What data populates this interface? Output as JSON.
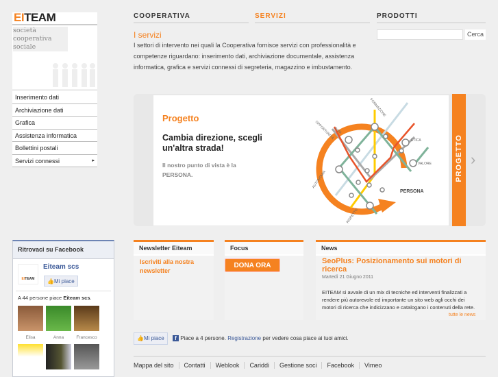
{
  "logo": {
    "brand_accent": "EI",
    "brand_rest": "TEAM",
    "tagline": [
      "società",
      "cooperativa",
      "sociale"
    ]
  },
  "nav": [
    {
      "label": "COOPERATIVA"
    },
    {
      "label": "SERVIZI",
      "active": true
    },
    {
      "label": "PRODOTTI"
    }
  ],
  "page": {
    "title": "I servizi",
    "intro": "I settori di intervento nei quali la Cooperativa fornisce servizi con professionalità e competenze riguardano: inserimento dati, archiviazione documentale, assistenza informatica, grafica e servizi connessi di segreteria, magazzino e imbustamento."
  },
  "search": {
    "value": "",
    "button": "Cerca"
  },
  "sidebar": {
    "items": [
      {
        "label": "Inserimento dati"
      },
      {
        "label": "Archiviazione dati"
      },
      {
        "label": "Grafica"
      },
      {
        "label": "Assistenza informatica"
      },
      {
        "label": "Bollettini postali"
      },
      {
        "label": "Servizi connessi",
        "submenu": "▸"
      }
    ]
  },
  "banner": {
    "kicker": "Progetto",
    "headline": "Cambia direzione, scegli un'altra strada!",
    "sub": "Il nostro punto di vista è la PERSONA.",
    "side_label": "PROGETTO",
    "next": "›",
    "diagram_labels": {
      "formazione": "FORMAZIONE",
      "pari": "PARI",
      "opportunita": "OPPORTUNITÀ",
      "etica": "ETICA",
      "valore": "VALORE",
      "autonomia": "AUTONOMIA",
      "rispetto": "RISPETTO",
      "persona": "PERSONA"
    }
  },
  "newsletter": {
    "title": "Newsletter Eiteam",
    "link": "Iscriviti alla nostra newsletter"
  },
  "focus": {
    "title": "Focus",
    "button": "DONA ORA"
  },
  "news": {
    "title": "News",
    "headline": "SeoPlus: Posizionamento sui motori di ricerca",
    "date": "Martedì 21 Giugno 2011",
    "body": "EITEAM si avvale di un mix di tecniche ed interventi finalizzati a rendere più autorevole ed importante un sito web agli occhi dei motori di ricerca che indicizzano e catalogano i contenuti della rete.",
    "all": "tutte le news"
  },
  "facebook": {
    "title": "Ritrovaci su Facebook",
    "page_name": "Eiteam scs",
    "like": "Mi piace",
    "count_prefix": "A 44 persone piace ",
    "count_name": "Eiteam scs",
    "count_suffix": ".",
    "fans": [
      {
        "name": "Elisa"
      },
      {
        "name": "Anna"
      },
      {
        "name": "Francesco"
      },
      {
        "name": ""
      },
      {
        "name": ""
      },
      {
        "name": ""
      }
    ]
  },
  "likebar": {
    "button": "Mi piace",
    "text1": "Piace a 4 persone.",
    "link": "Registrazione",
    "text2": "per vedere cosa piace ai tuoi amici."
  },
  "footer": {
    "links": [
      "Mappa del sito",
      "Contatti",
      "Weblook",
      "Cariddi",
      "Gestione soci",
      "Facebook",
      "Vimeo"
    ]
  },
  "colors": {
    "accent": "#f58220",
    "bg": "#efefef",
    "fb": "#3b5998"
  }
}
